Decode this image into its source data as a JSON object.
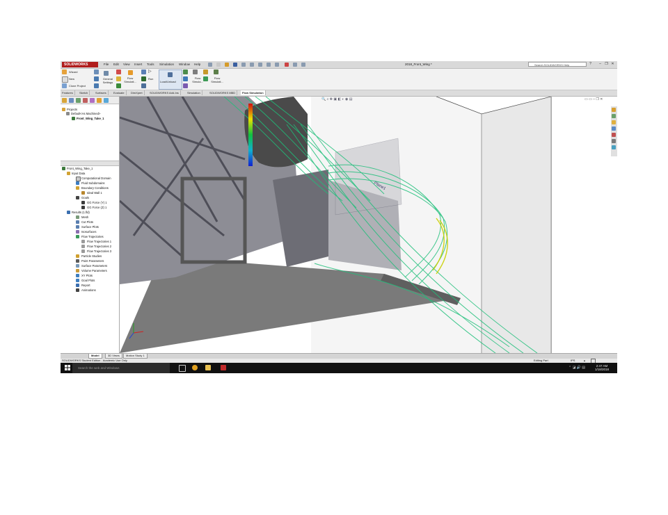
{
  "app": {
    "logo": "SOLIDWORKS",
    "menu": [
      "File",
      "Edit",
      "View",
      "Insert",
      "Tools",
      "Simulation",
      "Window",
      "Help"
    ],
    "document_title": "2018_Front_Wing *",
    "help_search_placeholder": "Search SOLIDWORKS Help"
  },
  "ribbon": {
    "wizard": "Wizard",
    "new": "New",
    "clone_project": "Clone Project",
    "general_settings": "General Settings",
    "flow_simulation_1": "Flow Simulati...",
    "run": "Run",
    "load_unload": "Load/Unload",
    "flow_simulation_2": "Flow Simula...",
    "flow_simulation_3": "Flow Simulati..."
  },
  "command_tabs": [
    "Features",
    "Sketch",
    "Surfaces",
    "Evaluate",
    "DimXpert",
    "SOLIDWORKS Add-Ins",
    "Simulation",
    "SOLIDWORKS MBD",
    "Flow Simulation"
  ],
  "active_command_tab": "Flow Simulation",
  "tree_top": {
    "projects": "Projects",
    "default_config": "Default<As Machined>",
    "project": "Front_Wing_Take_1"
  },
  "tree_bottom": {
    "root": "Front_Wing_Take_1",
    "input_data": "Input Data",
    "computational_domain": "Computational Domain",
    "fluid_subdomains": "Fluid Subdomains",
    "boundary_conditions": "Boundary Conditions",
    "ideal_wall": "Ideal Wall 1",
    "goals": "Goals",
    "gg_force_y": "GG Force (Y) 1",
    "gg_force_z": "GG Force (Z) 1",
    "results": "Results (1.fld)",
    "mesh": "Mesh",
    "cut_plots": "Cut Plots",
    "surface_plots": "Surface Plots",
    "isosurfaces": "Isosurfaces",
    "flow_trajectories": "Flow Trajectories",
    "flow_traj_1": "Flow Trajectories 1",
    "flow_traj_2": "Flow Trajectories 2",
    "flow_traj_3": "Flow Trajectories 3",
    "particle_studies": "Particle Studies",
    "point_parameters": "Point Parameters",
    "surface_parameters": "Surface Parameters",
    "volume_parameters": "Volume Parameters",
    "xy_plots": "XY Plots",
    "goal_plots": "Goal Plots",
    "report": "Report",
    "animations": "Animations"
  },
  "viewport": {
    "plane_label": "Plane1"
  },
  "bottom_tabs": [
    "Model",
    "3D Views",
    "Motion Study 1"
  ],
  "status": {
    "left": "SOLIDWORKS Student Edition - Academic Use Only",
    "editing": "Editing Part",
    "units": "IPS"
  },
  "taskbar": {
    "search_placeholder": "Search the web and Windows",
    "time": "2:47 AM",
    "date": "1/18/2018"
  },
  "colors": {
    "flow_green": "#1fbf7a",
    "flow_yellow": "#c9d000",
    "titlebar_red": "#b01c1c"
  }
}
